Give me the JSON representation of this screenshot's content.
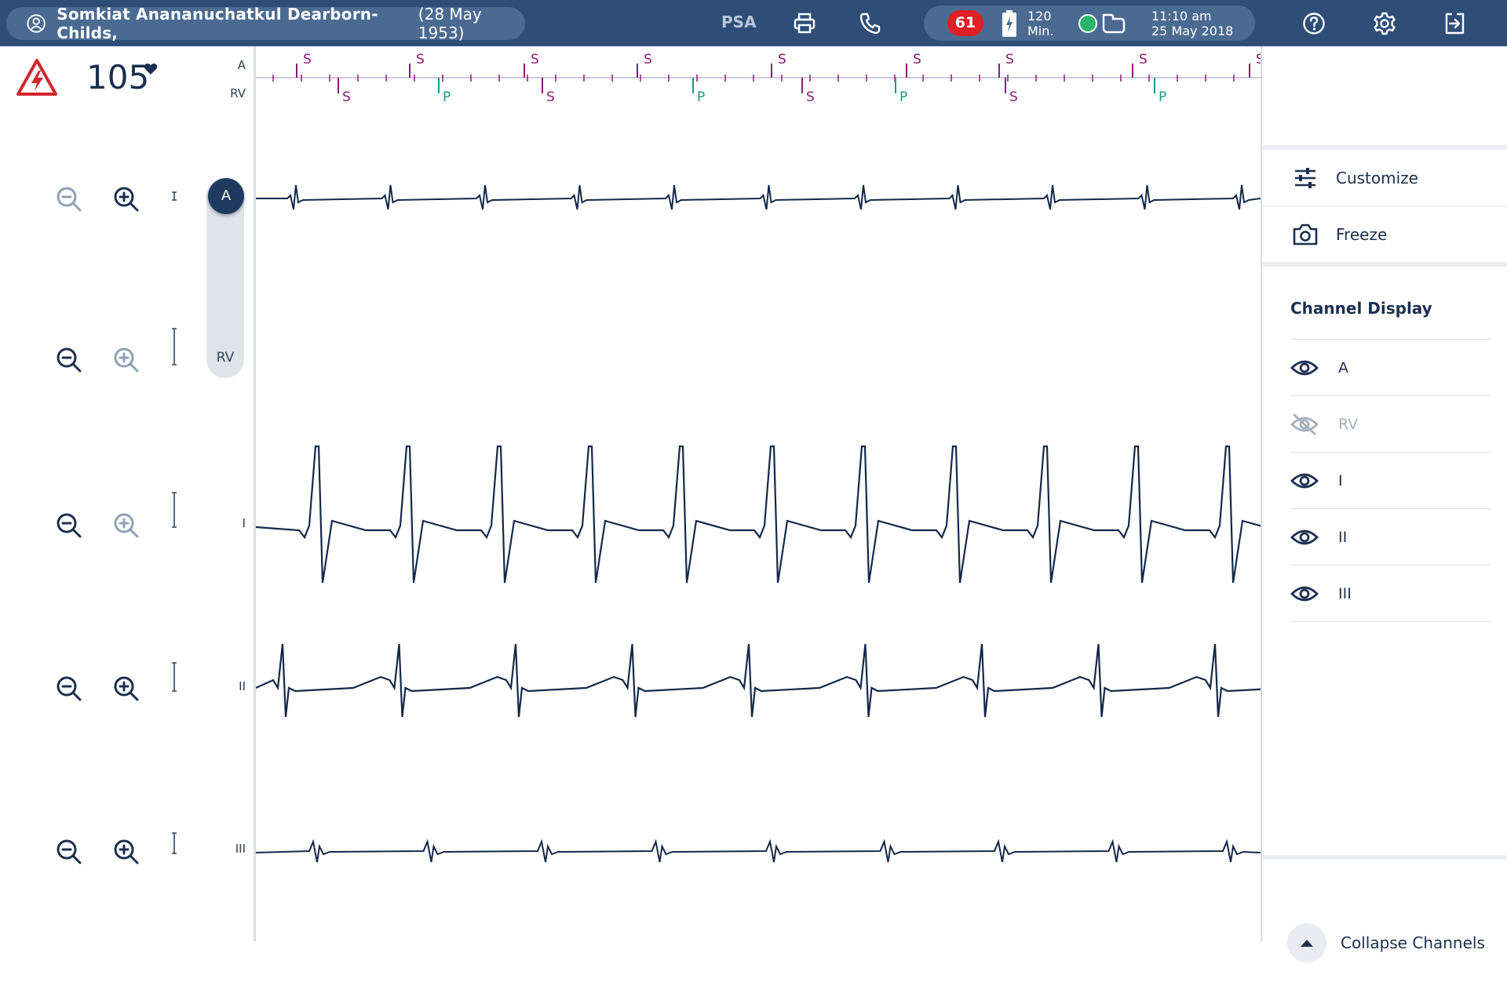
{
  "header": {
    "patient_name": "Somkiat Anananuchatkul Dearborn-Childs,",
    "patient_dob": "(28 May 1953)",
    "mode": "PSA",
    "alarm_count": "61",
    "battery_line1": "120",
    "battery_line2": "Min.",
    "time": "11:10 am",
    "date": "25 May 2018",
    "icons": [
      "user-icon",
      "print-icon",
      "phone-icon",
      "battery-icon",
      "connection-icon",
      "help-icon",
      "settings-icon",
      "exit-icon"
    ]
  },
  "vitals": {
    "heart_rate": "105",
    "alarm_icon": "alarm-warning-icon"
  },
  "channels": [
    "A",
    "RV",
    "I",
    "II",
    "III"
  ],
  "marker_labels": {
    "a": "A",
    "rv": "RV",
    "sense": "S",
    "pace": "P"
  },
  "slider": {
    "top": "A",
    "bottom": "RV"
  },
  "right_panel": {
    "customize": "Customize",
    "freeze": "Freeze",
    "channel_display_title": "Channel Display",
    "channel_display": [
      {
        "name": "A",
        "visible": true
      },
      {
        "name": "RV",
        "visible": false
      },
      {
        "name": "I",
        "visible": true
      },
      {
        "name": "II",
        "visible": true
      },
      {
        "name": "III",
        "visible": true
      }
    ],
    "collapse": "Collapse Channels"
  },
  "colors": {
    "header": "#2e4e78",
    "wave": "#14284a",
    "sense_marker": "#8a1a7a",
    "pace_marker": "#1a9a8c",
    "alarm_red": "#e01f27",
    "connected_green": "#2ab56c"
  }
}
